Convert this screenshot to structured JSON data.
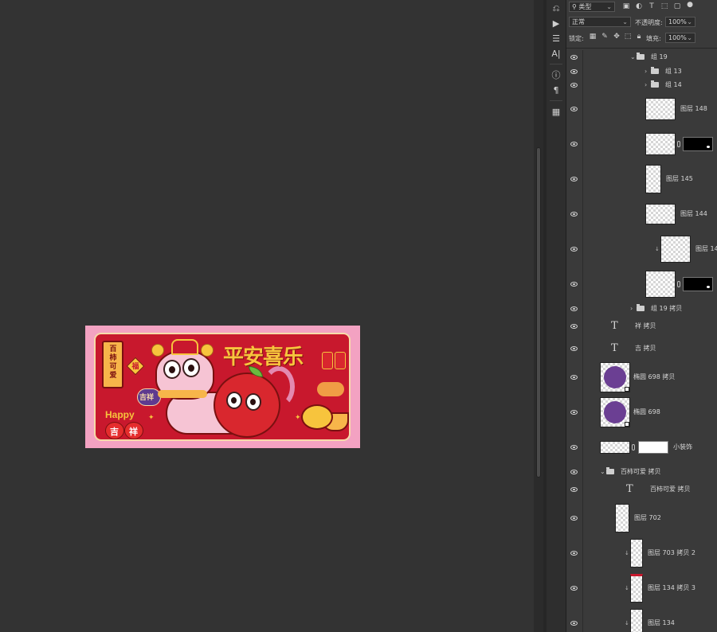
{
  "artwork": {
    "title": "平安喜乐",
    "scroll_text": "百柿可爱",
    "fu": "福",
    "jixiang_badge": "吉祥",
    "happy": "Happy",
    "apple_ji": "吉",
    "apple_xiang": "祥"
  },
  "tools": {
    "items": [
      "history-icon",
      "play-icon",
      "adjust-icon",
      "character-icon",
      "info-icon",
      "paragraph-icon",
      "library-icon"
    ]
  },
  "panel": {
    "filter_type": "类型",
    "blend_mode": "正常",
    "opacity_label": "不透明度:",
    "opacity_value": "100%",
    "lock_label": "锁定:",
    "fill_label": "填充:",
    "fill_value": "100%"
  },
  "layers": [
    {
      "name": "组 19",
      "kind": "group-open"
    },
    {
      "name": "组 13",
      "kind": "group"
    },
    {
      "name": "组 14",
      "kind": "group"
    },
    {
      "name": "图层 148",
      "kind": "pixel"
    },
    {
      "name": "",
      "kind": "pixel-mask"
    },
    {
      "name": "图层 145",
      "kind": "pixel"
    },
    {
      "name": "图层 144",
      "kind": "pixel"
    },
    {
      "name": "图层 14",
      "kind": "clipped"
    },
    {
      "name": "",
      "kind": "pixel-mask"
    },
    {
      "name": "组 19 拷贝",
      "kind": "group"
    },
    {
      "name": "祥 拷贝",
      "kind": "text"
    },
    {
      "name": "吉 拷贝",
      "kind": "text"
    },
    {
      "name": "椭圆 698 拷贝",
      "kind": "shape"
    },
    {
      "name": "椭圆 698",
      "kind": "shape"
    },
    {
      "name": "小装饰",
      "kind": "pixel-mask"
    },
    {
      "name": "百柿可爱 拷贝",
      "kind": "group-open"
    },
    {
      "name": "百柿可爱 拷贝",
      "kind": "text"
    },
    {
      "name": "图层 702",
      "kind": "pixel"
    },
    {
      "name": "图层 703 拷贝 2",
      "kind": "clipped"
    },
    {
      "name": "图层 134 拷贝 3",
      "kind": "clipped"
    },
    {
      "name": "图层 134",
      "kind": "clipped"
    }
  ],
  "colors": {
    "workspace": "#333333",
    "panel": "#3a3a3a",
    "art_background": "#f3a2c2",
    "card_red": "#c8182d",
    "gold": "#f7c43d",
    "purple": "#6b3f93"
  }
}
